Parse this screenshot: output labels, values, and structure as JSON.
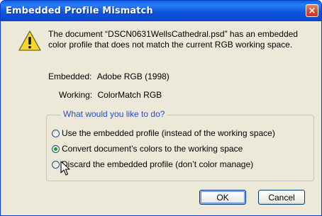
{
  "window": {
    "title": "Embedded Profile Mismatch",
    "close_glyph": "×"
  },
  "message": "The document “DSCN0631WellsCathedral.psd” has an embedded color profile that does not match the current RGB working space.",
  "embedded": {
    "label": "Embedded:",
    "value": "Adobe RGB (1998)"
  },
  "working": {
    "label": "Working:",
    "value": "ColorMatch RGB"
  },
  "group_label": "What would you like to do?",
  "options": [
    {
      "label": "Use the embedded profile (instead of the working space)",
      "selected": false
    },
    {
      "label": "Convert document’s colors to the working space",
      "selected": true
    },
    {
      "label": "Discard the embedded profile (don’t color manage)",
      "selected": false
    }
  ],
  "buttons": {
    "ok": "OK",
    "cancel": "Cancel"
  },
  "icons": {
    "warning": "warning-icon",
    "close": "close-icon",
    "cursor": "mouse-cursor-icon"
  },
  "colors": {
    "titlebar": "#0a5fe8",
    "dialog_bg": "#ece9d8",
    "group_label": "#2450c8",
    "close_button": "#d24a2b"
  }
}
